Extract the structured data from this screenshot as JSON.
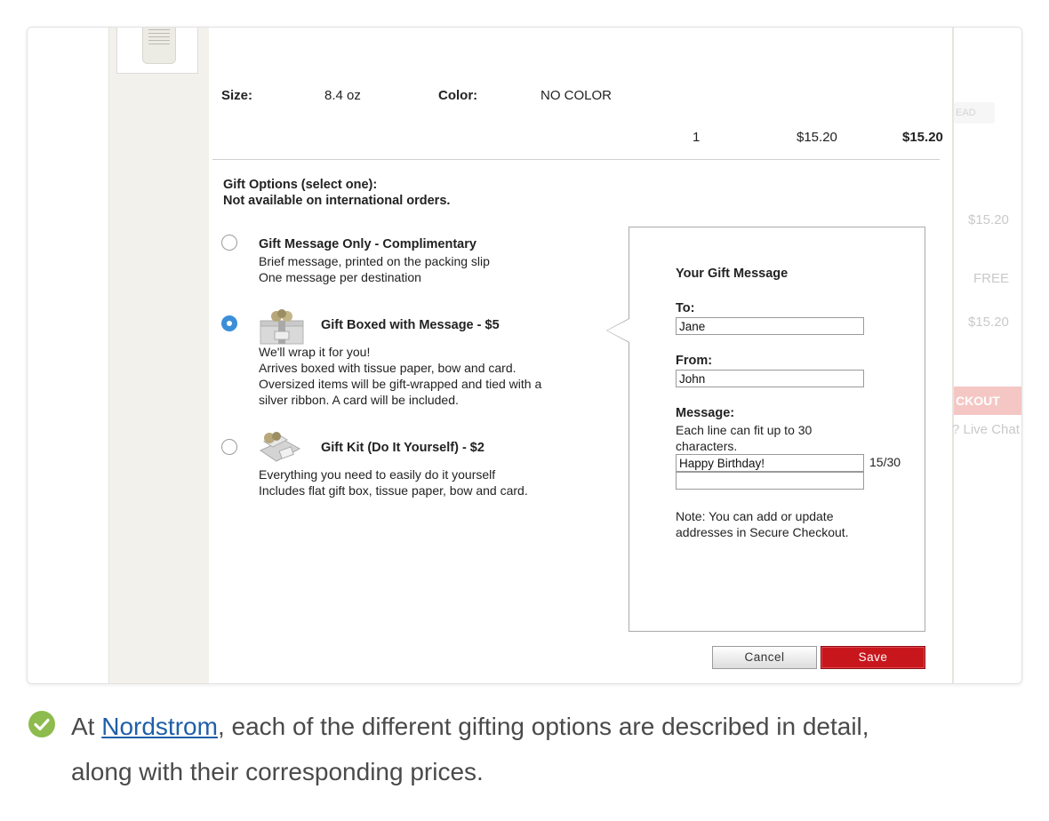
{
  "product": {
    "size_label": "Size:",
    "size_value": "8.4 oz",
    "color_label": "Color:",
    "color_value": "NO COLOR",
    "quantity": "1",
    "price": "$15.20",
    "total": "$15.20"
  },
  "gift_options": {
    "heading_line1": "Gift Options (select one):",
    "heading_line2": "Not available on international orders.",
    "selected_index": 1,
    "options": [
      {
        "title": "Gift Message Only - Complimentary",
        "lines": [
          "Brief message, printed on the packing slip",
          "One message per destination"
        ]
      },
      {
        "title": "Gift Boxed with Message - $5",
        "lines": [
          "We'll wrap it for you!",
          "Arrives boxed with tissue paper, bow and card.",
          "Oversized items will be gift-wrapped and tied with a",
          "silver ribbon. A card will be included."
        ]
      },
      {
        "title": "Gift Kit (Do It Yourself) - $2",
        "lines": [
          "Everything you need to easily do it yourself",
          "Includes flat gift box, tissue paper, bow and card."
        ]
      }
    ]
  },
  "gift_message": {
    "title": "Your Gift Message",
    "to_label": "To:",
    "to_value": "Jane",
    "from_label": "From:",
    "from_value": "John",
    "message_label": "Message:",
    "message_hint_line1": "Each line can fit up to 30",
    "message_hint_line2": "characters.",
    "message_line1": "Happy Birthday!",
    "message_line2": "",
    "counter": "15/30",
    "note_line1": "Note: You can add or update",
    "note_line2": "addresses in Secure Checkout.",
    "cancel_label": "Cancel",
    "save_label": "Save"
  },
  "right_column": {
    "tab_text": "EAD",
    "subtotal": "$15.20",
    "shipping": "FREE",
    "total": "$15.20",
    "checkout_label": "CKOUT",
    "live_chat": "? Live Chat"
  },
  "caption": {
    "prefix": "At ",
    "link_text": "Nordstrom",
    "rest_line1": ", each of the different gifting options are described in detail,",
    "line2": "along with their corresponding prices."
  },
  "colors": {
    "save_button": "#c8161d",
    "radio_selected": "#3b8fd9",
    "check_badge": "#8dbb4d",
    "link": "#1f5fa8"
  }
}
